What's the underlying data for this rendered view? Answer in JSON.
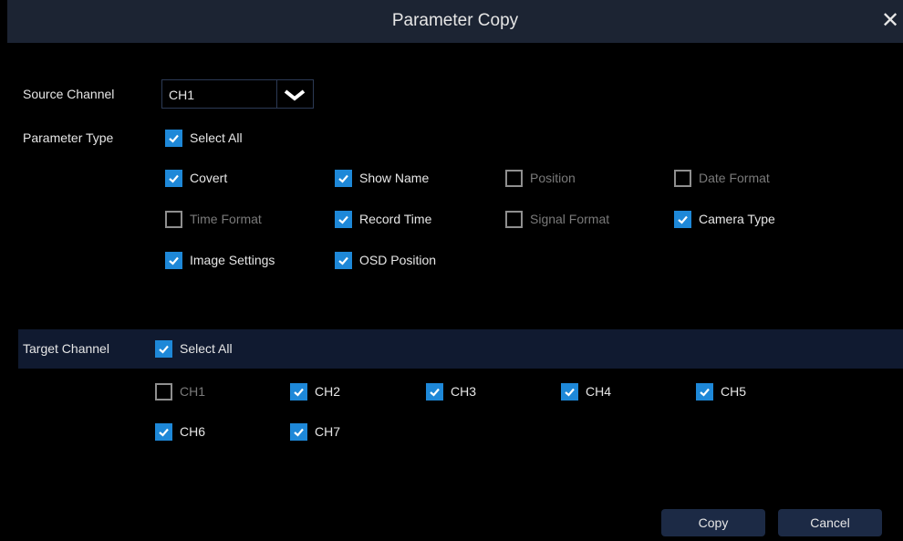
{
  "dialog": {
    "title": "Parameter Copy",
    "close_glyph": "✕"
  },
  "source_channel": {
    "label": "Source Channel",
    "value": "CH1"
  },
  "parameter_type": {
    "label": "Parameter Type",
    "select_all": {
      "label": "Select All",
      "checked": true
    },
    "options": [
      {
        "label": "Covert",
        "checked": true
      },
      {
        "label": "Show Name",
        "checked": true
      },
      {
        "label": "Position",
        "checked": false
      },
      {
        "label": "Date Format",
        "checked": false
      },
      {
        "label": "Time Format",
        "checked": false
      },
      {
        "label": "Record Time",
        "checked": true
      },
      {
        "label": "Signal Format",
        "checked": false
      },
      {
        "label": "Camera Type",
        "checked": true
      },
      {
        "label": "Image Settings",
        "checked": true
      },
      {
        "label": "OSD Position",
        "checked": true
      }
    ]
  },
  "target_channel": {
    "label": "Target Channel",
    "select_all": {
      "label": "Select All",
      "checked": true
    },
    "channels": [
      {
        "label": "CH1",
        "checked": false
      },
      {
        "label": "CH2",
        "checked": true
      },
      {
        "label": "CH3",
        "checked": true
      },
      {
        "label": "CH4",
        "checked": true
      },
      {
        "label": "CH5",
        "checked": true
      },
      {
        "label": "CH6",
        "checked": true
      },
      {
        "label": "CH7",
        "checked": true
      }
    ]
  },
  "buttons": {
    "copy": "Copy",
    "cancel": "Cancel"
  },
  "colors": {
    "accent": "#1e88d8",
    "titlebar": "#1c2433",
    "band": "#101a30",
    "button": "#1c2a45"
  }
}
